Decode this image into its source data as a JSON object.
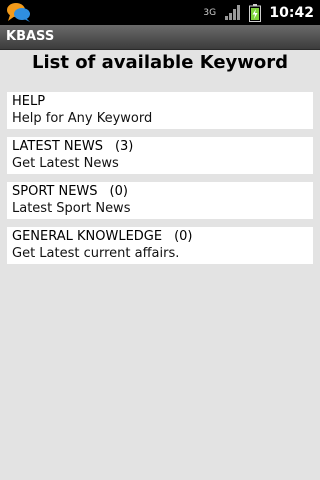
{
  "status_bar": {
    "notification_icon": "chat-bubbles-icon",
    "network_type": "3G",
    "signal_icon": "signal-bars-icon",
    "battery_icon": "battery-charging-icon",
    "time": "10:42"
  },
  "app_bar": {
    "title": "KBASS"
  },
  "page": {
    "heading": "List of available Keyword"
  },
  "keywords": [
    {
      "name": "HELP",
      "count": "",
      "description": "Help for Any Keyword"
    },
    {
      "name": "LATEST NEWS",
      "count": "(3)",
      "description": "Get Latest News"
    },
    {
      "name": "SPORT NEWS",
      "count": "(0)",
      "description": "Latest Sport News"
    },
    {
      "name": "GENERAL KNOWLEDGE",
      "count": "(0)",
      "description": "Get Latest current affairs."
    }
  ],
  "colors": {
    "background": "#e3e3e3",
    "status_bar": "#000000",
    "app_bar": "#4a4a4a",
    "item_background": "#ffffff",
    "battery_fill": "#7fd13b"
  }
}
